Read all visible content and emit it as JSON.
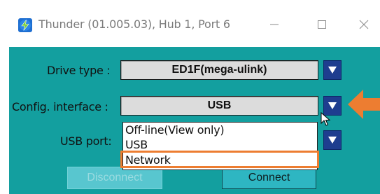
{
  "window": {
    "title": "Thunder (01.005.03), Hub 1, Port 6",
    "icon": "thunder-lightning-icon"
  },
  "form": {
    "drive_type_label": "Drive type :",
    "drive_type_value": "ED1F(mega-ulink)",
    "config_interface_label": "Config. interface :",
    "config_interface_value": "USB",
    "usb_port_label": "USB port:"
  },
  "dropdown": {
    "options": [
      "Off-line(View only)",
      "USB",
      "Network"
    ],
    "highlighted": "Network"
  },
  "buttons": {
    "disconnect": "Disconnect",
    "connect": "Connect"
  },
  "colors": {
    "client_bg": "#139f9f",
    "combo_button": "#1e3d8f",
    "highlight": "#ed7d31"
  }
}
